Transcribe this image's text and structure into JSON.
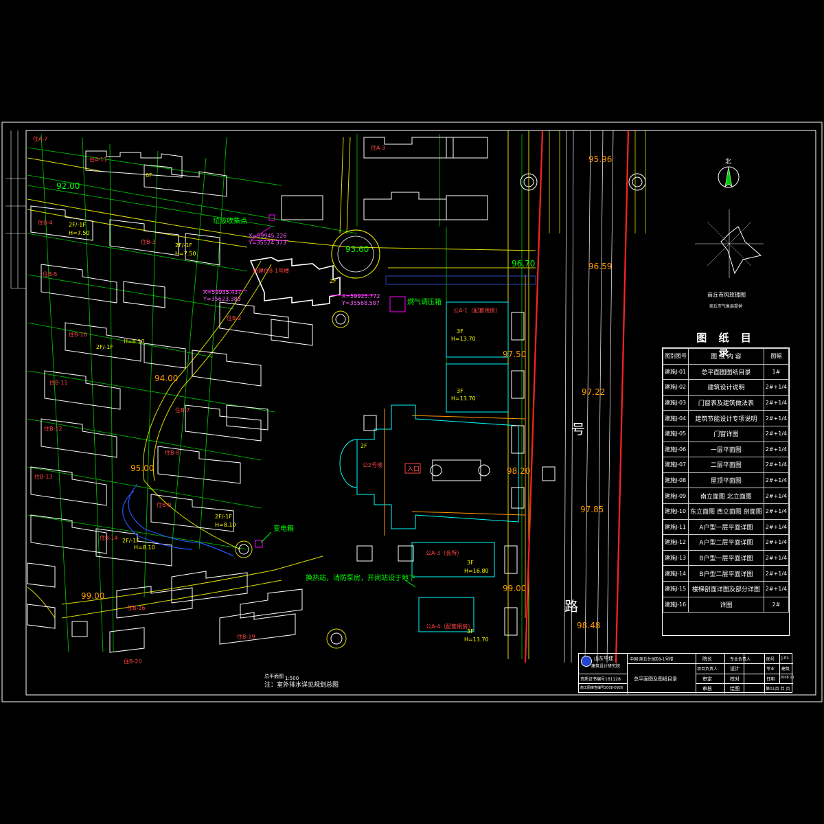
{
  "colors": {
    "background": "#000000",
    "border": "#ffffff",
    "building": "#ffffff",
    "road": "#ffff00",
    "grid": "#00ff00",
    "magenta": "#ff00ff",
    "cyan": "#00ffff",
    "red": "#ff0000",
    "orange": "#ff9900",
    "blue": "#0066ff"
  },
  "labels": {
    "collection_point": "垃圾收集点",
    "gas_station": "燃气调压箱",
    "transformer": "变电箱",
    "heat_note": "换热站，消防泵房，开闭站设于地下",
    "note_main": "注：室外排水详见规划总图",
    "scale_label": "总平面图",
    "scale_value": "1:500",
    "new_building": "新建住8-1号楼",
    "public2": "公2号楼",
    "entrance": "入口",
    "road_char1": "号",
    "road_char2": "路",
    "north": "北",
    "wind_caption": "商丘市风玫瑰图",
    "wind_sub": "商丘市气象局提供"
  },
  "coordinates": {
    "c1": "X=59935.437",
    "c1b": "Y=35623.383",
    "c2": "X=59925.772",
    "c2b": "Y=35568.587",
    "c3": "X=59945.226",
    "c3b": "Y=35524.373"
  },
  "elevations": {
    "e1": "92.00",
    "e2": "93.60",
    "e3": "94.00",
    "e4": "95.00",
    "e5": "99.00",
    "e6": "95.96",
    "e7": "96.70",
    "e8": "96.59",
    "e9": "97.50",
    "e10": "97.22",
    "e11": "98.20",
    "e12": "97.85",
    "e13": "99.00",
    "e14": "98.48"
  },
  "buildings": {
    "b_a7": "住A-7",
    "b_a11": "住A-11",
    "b_a3": "住A-3",
    "b_b4": "住B-4",
    "b_b3": "住B-3",
    "b_b5": "住B-5",
    "b_b10": "住B-10",
    "b_b11": "住B-11",
    "b_b12": "住B-12",
    "b_b13": "住B-13",
    "b_b14": "住B-14",
    "b_b16": "住B-16",
    "b_b19": "住B-19",
    "b_b20": "住B-20",
    "b_b2": "住B-2",
    "b_b7": "住B-7",
    "b_b8": "住B-8",
    "b_b9": "住B-9",
    "pub_a1": "公A-1（配套用房）",
    "pub_a3": "公A-3（会所）",
    "pub_a4": "公A-4（配套用房）",
    "floors_3f": "3F",
    "h_1370": "H=13.70",
    "h_1680": "H=16.80",
    "floors_2f1f": "2F/-1F",
    "h_750": "H=7.50",
    "h_810": "H=8.10",
    "floors_6f": "6F",
    "floors_2f": "2F"
  },
  "drawing_index": {
    "title": "图 纸 目 录",
    "header": [
      "图别图号",
      "图 纸 内 容",
      "图幅"
    ],
    "rows": [
      [
        "建施J-01",
        "总平面图图纸目录",
        "1#"
      ],
      [
        "建施J-02",
        "建筑设计说明",
        "2#+1/4"
      ],
      [
        "建施J-03",
        "门窗表及建筑做法表",
        "2#+1/4"
      ],
      [
        "建施J-04",
        "建筑节能设计专项说明",
        "2#+1/4"
      ],
      [
        "建施J-05",
        "门窗详图",
        "2#+1/4"
      ],
      [
        "建施J-06",
        "一层平面图",
        "2#+1/4"
      ],
      [
        "建施J-07",
        "二层平面图",
        "2#+1/4"
      ],
      [
        "建施J-08",
        "屋顶平面图",
        "2#+1/4"
      ],
      [
        "建施J-09",
        "南立面图 北立面图",
        "2#+1/4"
      ],
      [
        "建施J-10",
        "东立面图 西立面图 剖面图",
        "2#+1/4"
      ],
      [
        "建施J-11",
        "A户型一层平面详图",
        "2#+1/4"
      ],
      [
        "建施J-12",
        "A户型二层平面详图",
        "2#+1/4"
      ],
      [
        "建施J-13",
        "B户型一层平面详图",
        "2#+1/4"
      ],
      [
        "建施J-14",
        "B户型二层平面详图",
        "2#+1/4"
      ],
      [
        "建施J-15",
        "楼梯剖面详图及部分详图",
        "2#+1/4"
      ],
      [
        "建施J-16",
        "详图",
        "2#"
      ]
    ]
  },
  "title_block": {
    "company": "山东华建",
    "company_sub": "建筑设计研究院",
    "project": "中国·商丘住8区8-1号楼",
    "drawing_name": "总平面图及图纸目录",
    "cert": "资质证书编号161128",
    "cert2": "施工图审查编号2008-0926",
    "r1": [
      "院长",
      "专业负责人",
      "图号",
      "J-01"
    ],
    "r2": [
      "项目负责人",
      "设计",
      "专业",
      "建筑"
    ],
    "r3": [
      "审定",
      "校对",
      "日期",
      "2008.11"
    ],
    "r4": [
      "审核",
      "绘图",
      "第01页 共 页"
    ]
  }
}
